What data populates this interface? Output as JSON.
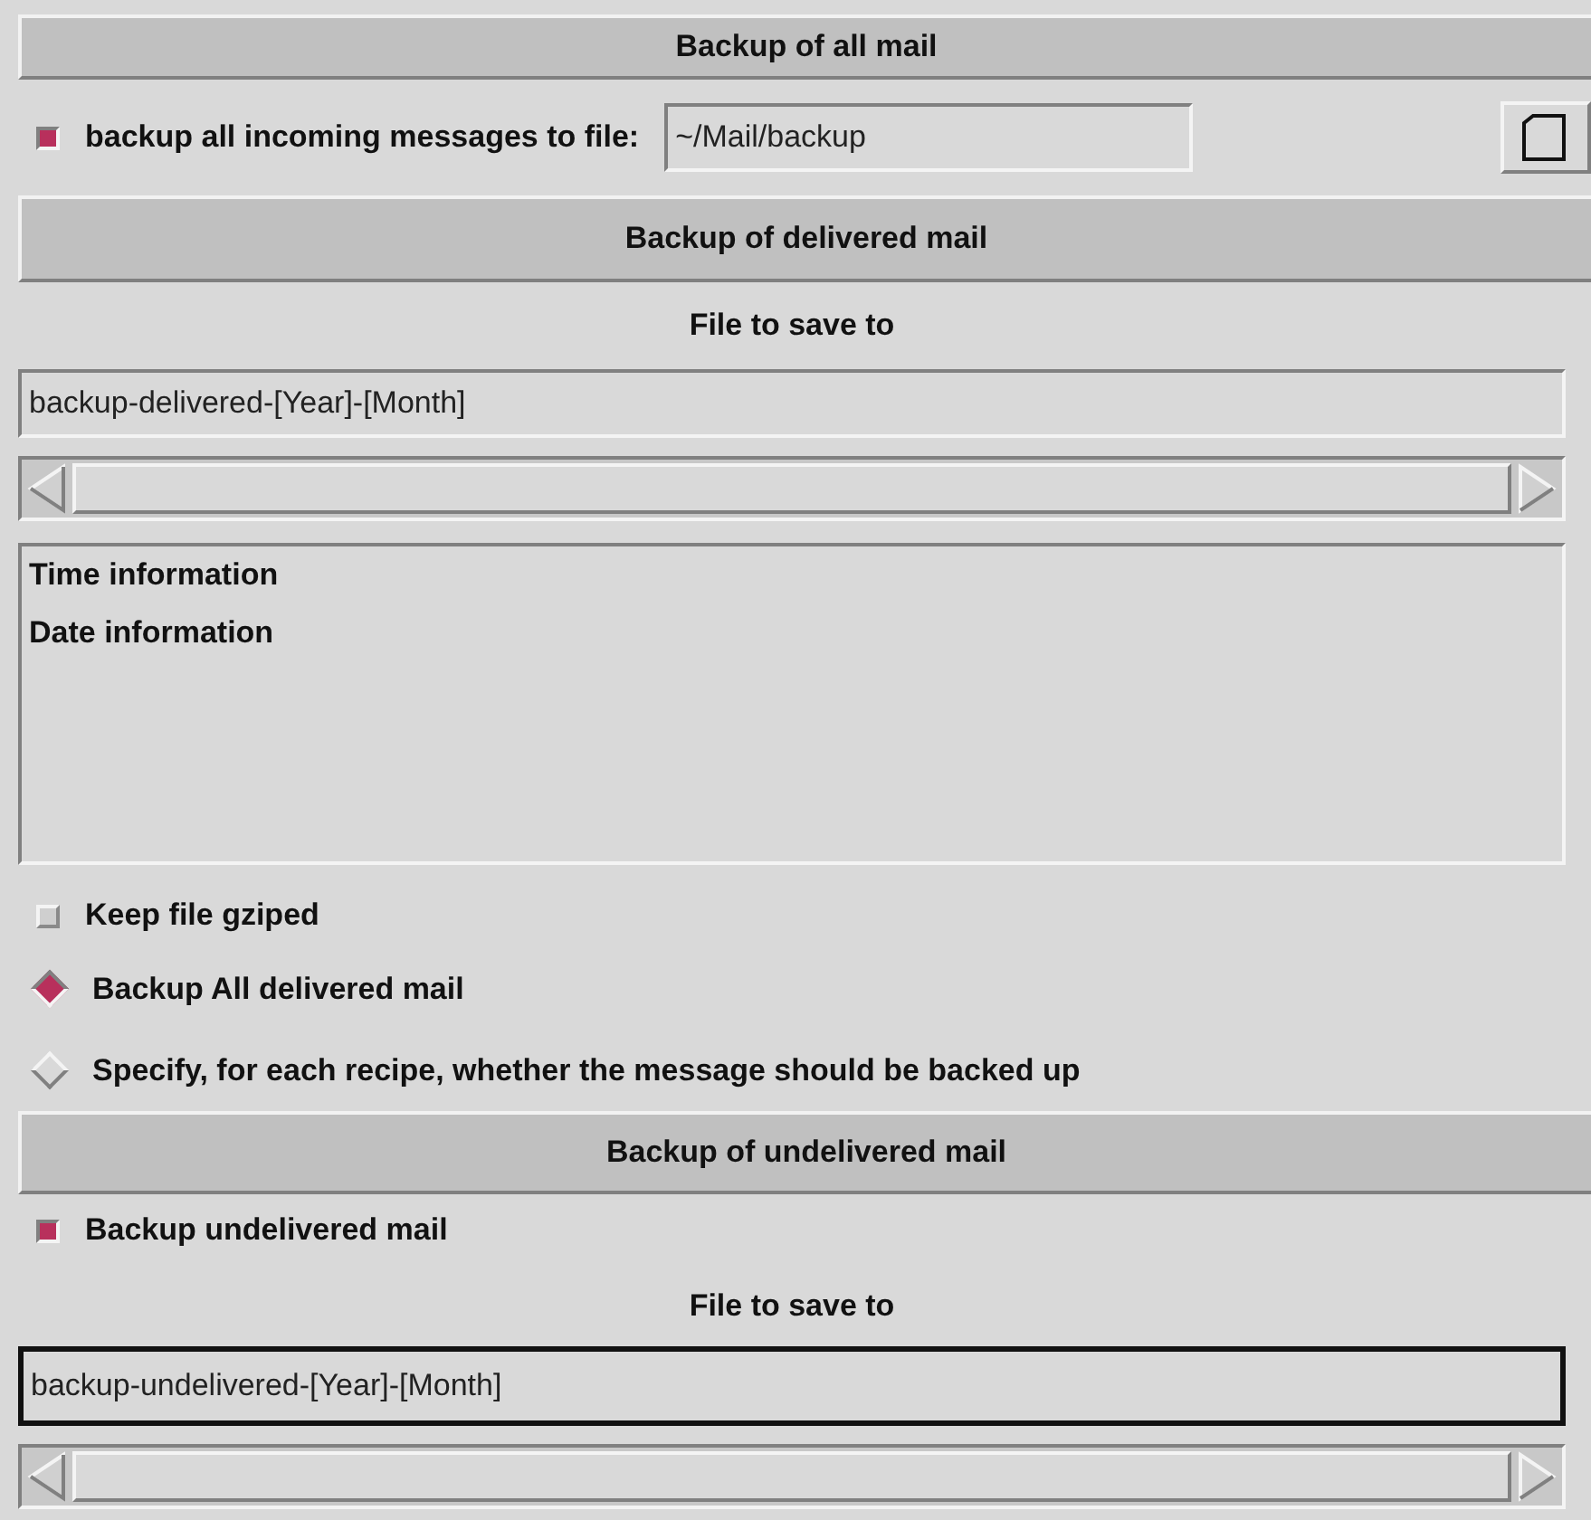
{
  "all_mail": {
    "title": "Backup of all mail",
    "checkbox": {
      "label": "backup all incoming messages to file:",
      "checked": true
    },
    "path_field": {
      "value": "~/Mail/backup"
    }
  },
  "delivered_mail": {
    "title": "Backup of delivered mail",
    "file_label": "File to save to",
    "file_field": {
      "value": "backup-delivered-[Year]-[Month]",
      "focused": false
    },
    "list_items": [
      "Time information",
      "Date information"
    ],
    "gzip": {
      "label": "Keep file gziped",
      "checked": false
    },
    "radios": [
      {
        "label": "Backup All delivered mail",
        "selected": true
      },
      {
        "label": "Specify, for each recipe, whether the message should be backed up",
        "selected": false
      }
    ]
  },
  "undelivered_mail": {
    "title": "Backup of undelivered mail",
    "checkbox": {
      "label": "Backup undelivered mail",
      "checked": true
    },
    "file_label": "File to save to",
    "file_field": {
      "value": "backup-undelivered-[Year]-[Month]",
      "focused": true
    }
  }
}
